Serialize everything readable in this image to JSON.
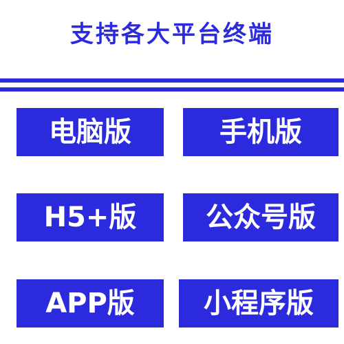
{
  "title": "支持各大平台终端",
  "tiles": [
    {
      "label": "电脑版"
    },
    {
      "label": "手机版"
    },
    {
      "label": "H5+版"
    },
    {
      "label": "公众号版"
    },
    {
      "label": "APP版"
    },
    {
      "label": "小程序版"
    }
  ],
  "colors": {
    "accent": "#2b2bdd",
    "tile_text": "#ffffff",
    "background": "#ffffff"
  }
}
